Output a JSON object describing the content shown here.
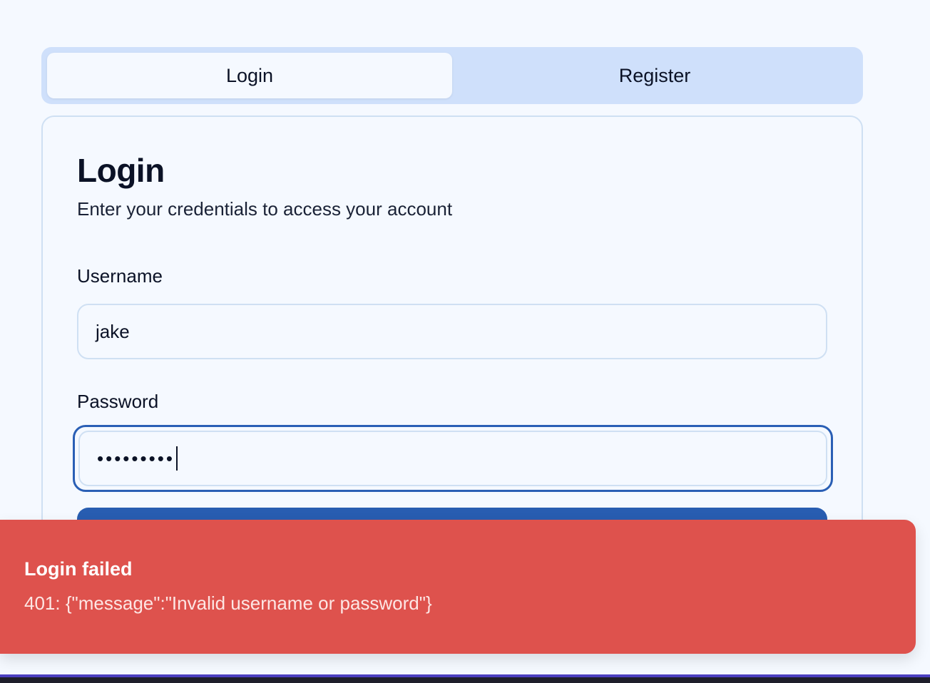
{
  "tabs": [
    {
      "label": "Login",
      "active": true
    },
    {
      "label": "Register",
      "active": false
    }
  ],
  "card": {
    "title": "Login",
    "subtitle": "Enter your credentials to access your account",
    "username": {
      "label": "Username",
      "value": "jake"
    },
    "password": {
      "label": "Password",
      "masked_value": "•••••••••"
    }
  },
  "toast": {
    "title": "Login failed",
    "description": "401: {\"message\":\"Invalid username or password\"}"
  },
  "colors": {
    "accent": "#285db1",
    "error": "#de524d",
    "tab_bar": "#cfe0fb",
    "background": "#f5f9ff"
  }
}
